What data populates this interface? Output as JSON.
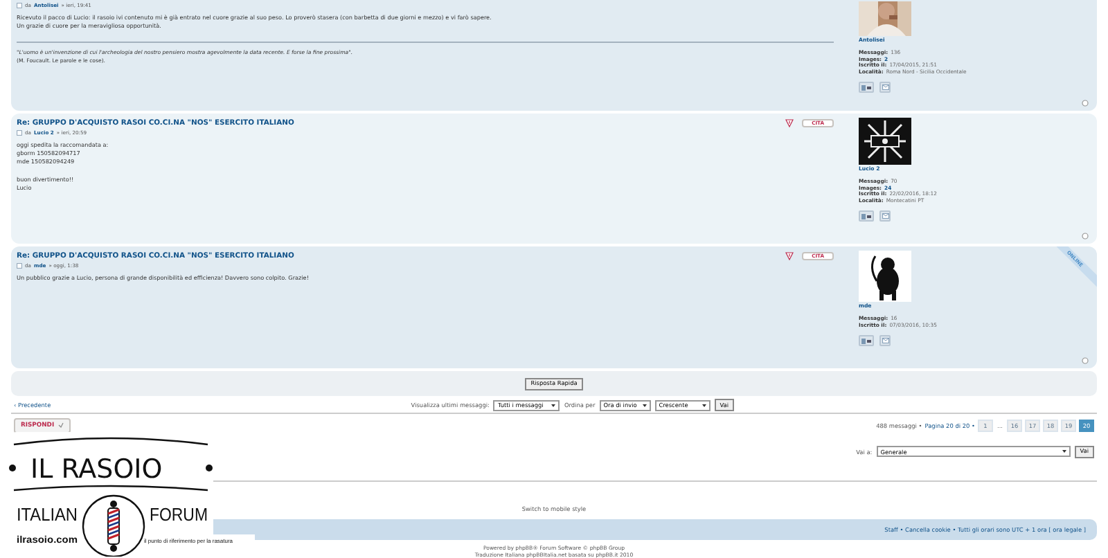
{
  "posts": [
    {
      "author_prefix": "da",
      "author": "Antolisei",
      "time": "» ieri, 19:41",
      "body": [
        [
          "Ricevuto il pacco di Lucio: il rasoio ivi contenuto mi è già entrato nel cuore grazie al suo peso. Lo proverò stasera (con barbetta di due giorni e mezzo) e vi farò sapere.",
          "Un grazie di cuore per la meravigliosa opportunità."
        ]
      ],
      "signature": [
        {
          "text": "\"L'uomo è un'invenzione di cui l'archeologia del nostro pensiero mostra agevolmente la data recente. E forse la fine prossima\".",
          "italic": true
        },
        {
          "text": "(M. Foucault. Le parole e le cose).",
          "italic": false
        }
      ],
      "avatar": {
        "kind": "picture"
      },
      "profile_name": "Antolisei",
      "profile": [
        {
          "label": "Messaggi:",
          "value": "136",
          "kind": "text"
        },
        {
          "label": "Images:",
          "value": "2",
          "kind": "link"
        },
        {
          "label": "Iscritto il:",
          "value": "17/04/2015, 21:51",
          "kind": "text"
        },
        {
          "label": "Località:",
          "value": "Roma Nord - Sicilia Occidentale",
          "kind": "text"
        }
      ]
    },
    {
      "subject": "Re: GRUPPO D'ACQUISTO RASOI CO.CI.NA \"NOS\" ESERCITO ITALIANO",
      "quote_label": "CITA",
      "author_prefix": "da",
      "author": "Lucio 2",
      "time": "» ieri, 20:59",
      "body": [
        [
          "oggi spedita la raccomandata a:",
          "gborm 150582094717",
          "mde 150582094249"
        ],
        [
          "buon divertimento!!",
          "Lucio"
        ]
      ],
      "avatar": {
        "kind": "picture"
      },
      "profile_name": "Lucio 2",
      "profile": [
        {
          "label": "Messaggi:",
          "value": "70",
          "kind": "text"
        },
        {
          "label": "Images:",
          "value": "24",
          "kind": "link"
        },
        {
          "label": "Iscritto il:",
          "value": "22/02/2016, 18:12",
          "kind": "text"
        },
        {
          "label": "Località:",
          "value": "Montecatini PT",
          "kind": "text"
        }
      ]
    },
    {
      "subject": "Re: GRUPPO D'ACQUISTO RASOI CO.CI.NA \"NOS\" ESERCITO ITALIANO",
      "quote_label": "CITA",
      "author_prefix": "da",
      "author": "mde",
      "time": "» oggi, 1:38",
      "body": [
        [
          "Un pubblico grazie a Lucio, persona di grande disponibilità ed efficienza! Davvero sono colpito. Grazie!"
        ]
      ],
      "online_badge": "ONLINE",
      "avatar": {
        "kind": "picture"
      },
      "profile_name": "mde",
      "profile": [
        {
          "label": "Messaggi:",
          "value": "16",
          "kind": "text"
        },
        {
          "label": "Iscritto il:",
          "value": "07/03/2016, 10:35",
          "kind": "text"
        }
      ]
    }
  ],
  "quick_reply": "Risposta Rapida",
  "nav": {
    "previous": "‹ Precedente",
    "show_label": "Visualizza ultimi messaggi:",
    "show_value": "Tutti i messaggi",
    "sort_label": "Ordina per",
    "sort_value": "Ora di invio",
    "order_value": "Crescente",
    "go": "Vai"
  },
  "reply_button": "RISPONDI",
  "pagination": {
    "count": "488 messaggi •",
    "page": "Pagina 20 di 20 •",
    "pages": [
      {
        "label": "1",
        "kind": "page",
        "selected": false
      },
      {
        "label": "...",
        "kind": "ellipsis"
      },
      {
        "label": "16",
        "kind": "page",
        "selected": false
      },
      {
        "label": "17",
        "kind": "page",
        "selected": false
      },
      {
        "label": "18",
        "kind": "page",
        "selected": false
      },
      {
        "label": "19",
        "kind": "page",
        "selected": false
      },
      {
        "label": "20",
        "kind": "page",
        "selected": true
      }
    ]
  },
  "jump": {
    "label": "Vai a:",
    "value": "Generale",
    "go": "Vai"
  },
  "mobile_switch": "Switch to mobile style",
  "footer_links": "Staff • Cancella cookie • Tutti gli orari sono UTC + 1 ora [ ora legale ]",
  "credits": [
    "Powered by phpBB® Forum Software © phpBB Group",
    "Traduzione Italiana phpBBItalia.net basata su phpBB.it 2010"
  ],
  "logo": {
    "title": "IL RASOIO",
    "left": "ITALIAN",
    "right": "FORUM",
    "site": "ilrasoio.com",
    "tagline": "il punto di riferimento per la rasatura"
  }
}
